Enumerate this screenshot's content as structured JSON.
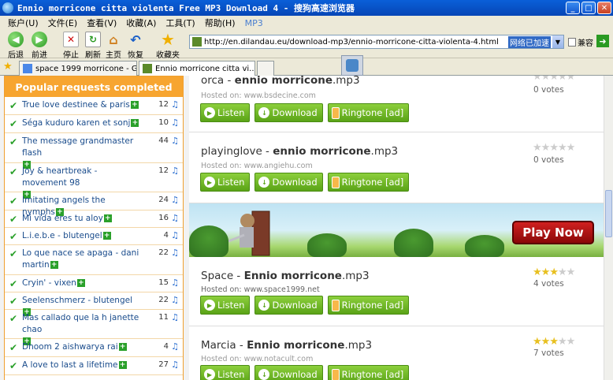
{
  "window": {
    "title": "Ennio morricone citta violenta Free MP3 Download 4 - 搜狗高速浏览器"
  },
  "menu": {
    "items": [
      "账户(U)",
      "文件(E)",
      "查看(V)",
      "收藏(A)",
      "工具(T)",
      "帮助(H)"
    ],
    "mp3": "MP3"
  },
  "toolbar": {
    "back": "后退",
    "forward": "前进",
    "stop": "停止",
    "refresh": "刷新",
    "home": "主页",
    "restore": "恢复",
    "favorites": "收藏夹"
  },
  "address": {
    "url": "http://en.dilandau.eu/download-mp3/ennio-morricone-citta-violenta-4.html",
    "accel": "网络已加速",
    "compat": "兼容"
  },
  "tabs": [
    {
      "label": "space 1999 morricone - Goo..."
    },
    {
      "label": "Ennio morricone citta vi..."
    }
  ],
  "sidebar": {
    "title": "Popular requests completed",
    "items": [
      {
        "label": "True love destinee & paris",
        "count": "12"
      },
      {
        "label": "Séga kuduro karen et sonj",
        "count": "10"
      },
      {
        "label": "The message grandmaster flash",
        "count": "44"
      },
      {
        "label": "Joy & heartbreak - movement 98",
        "count": "12"
      },
      {
        "label": "Imitating angels the nymphs",
        "count": "24"
      },
      {
        "label": "Mi vida eres tu aloy",
        "count": "16"
      },
      {
        "label": "L.i.e.b.e - blutengel",
        "count": "4"
      },
      {
        "label": "Lo que nace se apaga - dani martin",
        "count": "22"
      },
      {
        "label": "Cryin' - vixen",
        "count": "15"
      },
      {
        "label": "Seelenschmerz - blutengel",
        "count": "22"
      },
      {
        "label": "Mas callado que la h janette chao",
        "count": "11"
      },
      {
        "label": "Dhoom 2 aishwarya rai",
        "count": "4"
      },
      {
        "label": "A love to last a lifetime",
        "count": "27"
      }
    ]
  },
  "buttons": {
    "listen": "Listen",
    "download": "Download",
    "ringtone": "Ringtone [ad]"
  },
  "results": [
    {
      "title_a": "orca - ",
      "title_b": "ennio morricone",
      "ext": ".mp3",
      "hosted": "Hosted on: www.bsdecine.com",
      "rating": 0,
      "votes": "0 votes"
    },
    {
      "title_a": "playinglove - ",
      "title_b": "ennio morricone",
      "ext": ".mp3",
      "hosted": "Hosted on: www.angiehu.com",
      "rating": 0,
      "votes": "0 votes"
    },
    {
      "title_a": "Space - ",
      "title_b": "Ennio morricone",
      "ext": ".mp3",
      "hosted": "Hosted on: www.space1999.net",
      "rating": 3,
      "votes": "4 votes"
    },
    {
      "title_a": "Marcia - ",
      "title_b": "Ennio morricone",
      "ext": ".mp3",
      "hosted": "Hosted on: www.notacult.com",
      "rating": 3,
      "votes": "7 votes"
    }
  ],
  "banner": {
    "cta": "Play Now"
  }
}
